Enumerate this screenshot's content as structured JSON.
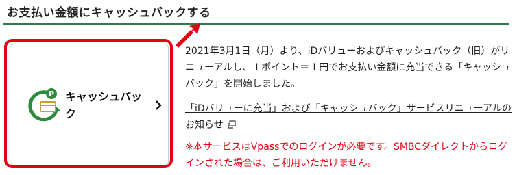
{
  "section": {
    "heading": "お支払い金額にキャッシュバックする"
  },
  "card": {
    "label": "キャッシュバック",
    "icon": "cashback-coin-icon",
    "chevron": "chevron-right-icon"
  },
  "content": {
    "description": "2021年3月1日（月）より、iDバリューおよびキャッシュバック（旧）がリニューアルし、１ポイント＝１円でお支払い金額に充当できる「キャッシュバック」を開始しました。",
    "link_text": "「iDバリューに充当」および「キャッシュバック」サービスリニューアルのお知らせ",
    "note": "※本サービスはVpassでのログインが必要です。SMBCダイレクトからログインされた場合は、ご利用いただけません。"
  },
  "colors": {
    "accent_green": "#2f7d4f",
    "highlight_red": "#e60012",
    "icon_green": "#2e8b3e",
    "icon_gold": "#c8a227"
  }
}
